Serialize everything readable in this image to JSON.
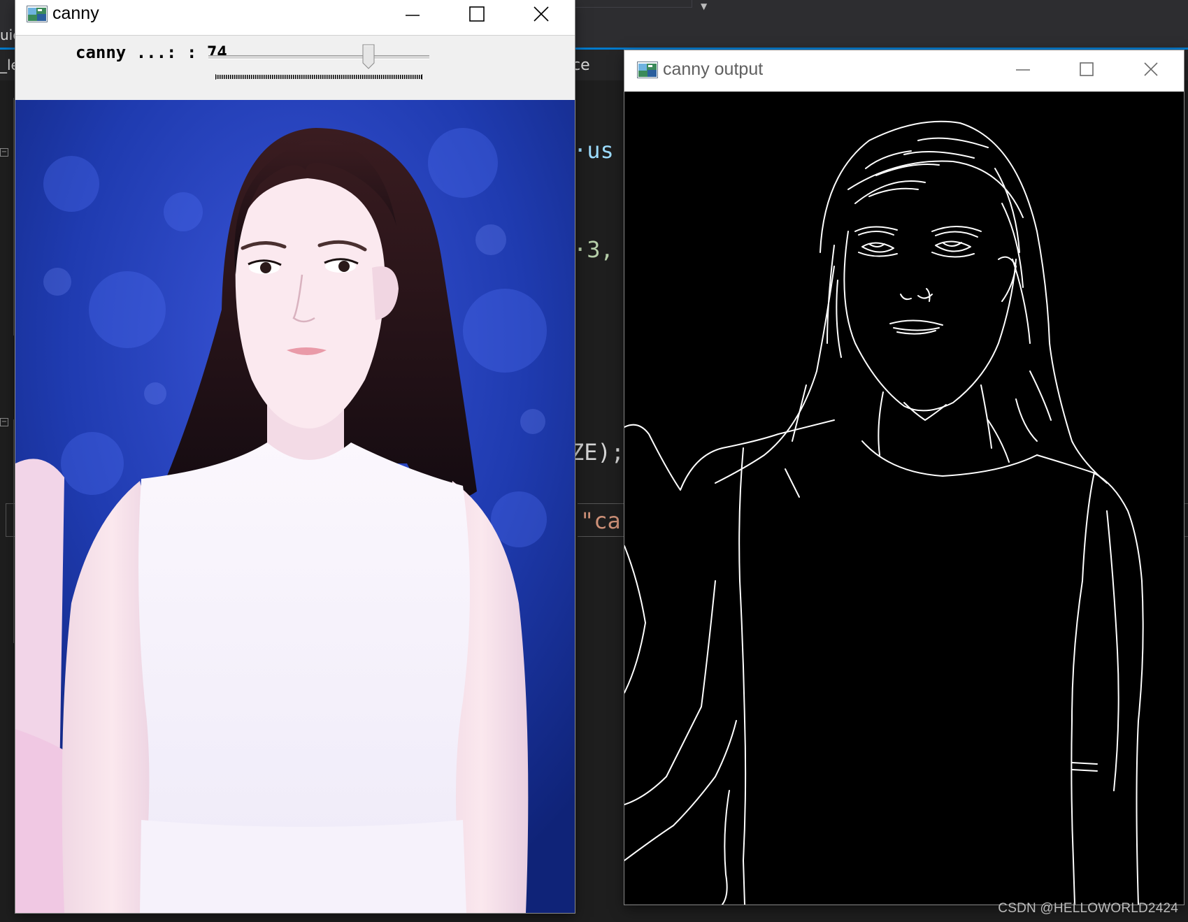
{
  "background_ide": {
    "topbar_fragment": "uic",
    "tab_fragment_left": "_le",
    "tab_fragment_right": "ce",
    "code_fragments": [
      "·us",
      "·3,",
      "ZE);",
      "\"ca"
    ]
  },
  "canny_window": {
    "title": "canny",
    "trackbar": {
      "label": "canny ...: : 74",
      "value": 74,
      "max": 100
    }
  },
  "output_window": {
    "title": "canny output"
  },
  "watermark": "CSDN @HELLOWORLD2424",
  "colors": {
    "ide_background": "#1e1e1e",
    "ide_accent": "#007acc",
    "trackbar_background": "#f0f0f0",
    "edge_lines": "#ffffff",
    "edge_background": "#000000"
  }
}
